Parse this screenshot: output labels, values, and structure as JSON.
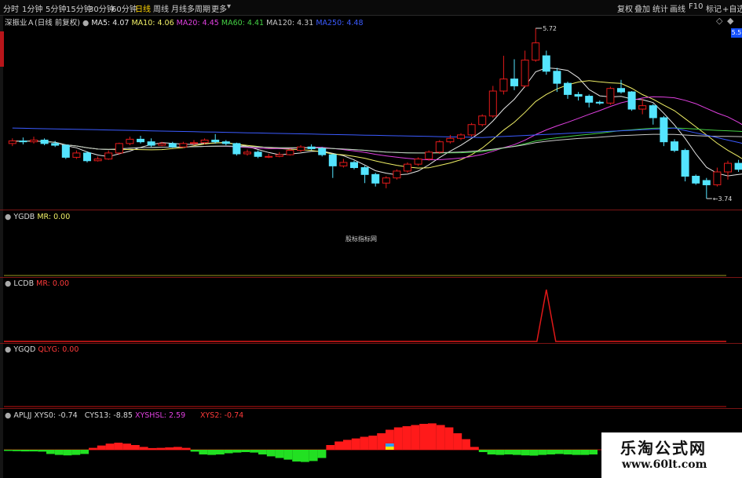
{
  "toolbar": {
    "periods": [
      "分时",
      "1分钟",
      "5分钟",
      "15分钟",
      "30分钟",
      "60分钟",
      "日线",
      "周线",
      "月线",
      "多周期",
      "更多"
    ],
    "active": "日线",
    "right_buttons": [
      "复权",
      "叠加",
      "统计",
      "画线",
      "F10",
      "标记",
      "+自选"
    ]
  },
  "main": {
    "stock_name": "深振业Ａ",
    "mode": "(日线 前复权)",
    "ma_labels": [
      {
        "key": "MA5",
        "text": "MA5: 4.07"
      },
      {
        "key": "MA10",
        "text": "MA10: 4.06"
      },
      {
        "key": "MA20",
        "text": "MA20: 4.45"
      },
      {
        "key": "MA60",
        "text": "MA60: 4.41"
      },
      {
        "key": "MA120",
        "text": "MA120: 4.31"
      },
      {
        "key": "MA250",
        "text": "MA250: 4.48"
      }
    ],
    "high_label": "5.72",
    "low_label": "3.74",
    "right_scale": "5.5"
  },
  "panels": {
    "ygdb": {
      "name": "YGDB",
      "values": [
        "MR: 0.00"
      ],
      "watermark": "股标指标网"
    },
    "lcdb": {
      "name": "LCDB",
      "values": [
        "MR: 0.00"
      ]
    },
    "ygqd": {
      "name": "YGQD",
      "values": [
        "QLYG: 0.00"
      ]
    },
    "apljj": {
      "name": "APLJJ",
      "values": [
        "XYS0: -0.74",
        "CYS13: -8.85",
        "XYSHSL: 2.59",
        "XYS2: -0.74"
      ]
    }
  },
  "logo": {
    "title": "乐淘公式网",
    "url": "www.60lt.com"
  },
  "colors": {
    "up": "#e31a1a",
    "down": "#54e4ff",
    "bg": "#000000",
    "ma5": "#e6e6e6",
    "ma10": "#f0ef66",
    "ma20": "#e040e0",
    "ma60": "#44d044",
    "ma120": "#c8c8c8",
    "ma250": "#3b5bff"
  },
  "chart_data": {
    "type": "candlestick",
    "candles": [
      [
        4.38,
        4.41,
        4.44,
        4.35
      ],
      [
        4.41,
        4.4,
        4.45,
        4.37
      ],
      [
        4.4,
        4.42,
        4.46,
        4.38
      ],
      [
        4.42,
        4.38,
        4.44,
        4.36
      ],
      [
        4.38,
        4.36,
        4.41,
        4.34
      ],
      [
        4.36,
        4.22,
        4.37,
        4.2
      ],
      [
        4.22,
        4.27,
        4.3,
        4.2
      ],
      [
        4.27,
        4.18,
        4.29,
        4.16
      ],
      [
        4.18,
        4.2,
        4.23,
        4.17
      ],
      [
        4.2,
        4.27,
        4.3,
        4.19
      ],
      [
        4.27,
        4.38,
        4.39,
        4.25
      ],
      [
        4.38,
        4.43,
        4.46,
        4.36
      ],
      [
        4.43,
        4.4,
        4.47,
        4.38
      ],
      [
        4.4,
        4.36,
        4.44,
        4.34
      ],
      [
        4.36,
        4.38,
        4.4,
        4.35
      ],
      [
        4.38,
        4.34,
        4.4,
        4.33
      ],
      [
        4.34,
        4.38,
        4.4,
        4.33
      ],
      [
        4.38,
        4.39,
        4.42,
        4.36
      ],
      [
        4.39,
        4.42,
        4.44,
        4.37
      ],
      [
        4.42,
        4.4,
        4.49,
        4.38
      ],
      [
        4.4,
        4.38,
        4.42,
        4.36
      ],
      [
        4.38,
        4.26,
        4.39,
        4.24
      ],
      [
        4.26,
        4.28,
        4.31,
        4.24
      ],
      [
        4.28,
        4.23,
        4.3,
        4.21
      ],
      [
        4.23,
        4.23,
        4.26,
        4.21
      ],
      [
        4.23,
        4.25,
        4.28,
        4.22
      ],
      [
        4.25,
        4.3,
        4.32,
        4.24
      ],
      [
        4.3,
        4.34,
        4.36,
        4.28
      ],
      [
        4.34,
        4.32,
        4.37,
        4.3
      ],
      [
        4.32,
        4.25,
        4.34,
        4.23
      ],
      [
        4.25,
        4.12,
        4.26,
        3.98
      ],
      [
        4.12,
        4.16,
        4.2,
        4.1
      ],
      [
        4.16,
        4.1,
        4.18,
        4.08
      ],
      [
        4.1,
        4.02,
        4.12,
        3.92
      ],
      [
        4.02,
        3.92,
        4.04,
        3.88
      ],
      [
        3.92,
        3.98,
        4.0,
        3.86
      ],
      [
        3.98,
        4.06,
        4.08,
        3.96
      ],
      [
        4.06,
        4.14,
        4.16,
        4.04
      ],
      [
        4.14,
        4.2,
        4.22,
        4.12
      ],
      [
        4.2,
        4.28,
        4.3,
        4.18
      ],
      [
        4.28,
        4.4,
        4.42,
        4.26
      ],
      [
        4.4,
        4.44,
        4.48,
        4.38
      ],
      [
        4.44,
        4.48,
        4.5,
        4.42
      ],
      [
        4.48,
        4.6,
        4.62,
        4.46
      ],
      [
        4.6,
        4.7,
        4.72,
        4.58
      ],
      [
        4.7,
        4.99,
        5.05,
        4.68
      ],
      [
        4.99,
        5.13,
        5.4,
        4.95
      ],
      [
        5.13,
        5.05,
        5.36,
        5.0
      ],
      [
        5.05,
        5.35,
        5.46,
        5.03
      ],
      [
        5.35,
        5.55,
        5.72,
        5.33
      ],
      [
        5.4,
        5.22,
        5.46,
        5.18
      ],
      [
        5.22,
        5.08,
        5.26,
        4.98
      ],
      [
        5.08,
        4.95,
        5.1,
        4.9
      ],
      [
        4.95,
        4.93,
        4.98,
        4.88
      ],
      [
        4.93,
        4.86,
        4.95,
        4.8
      ],
      [
        4.86,
        4.85,
        4.88,
        4.83
      ],
      [
        4.85,
        5.02,
        5.04,
        4.83
      ],
      [
        5.02,
        4.98,
        5.12,
        4.96
      ],
      [
        4.98,
        4.78,
        4.99,
        4.76
      ],
      [
        4.78,
        4.82,
        4.9,
        4.72
      ],
      [
        4.82,
        4.68,
        4.84,
        4.6
      ],
      [
        4.68,
        4.4,
        4.7,
        4.35
      ],
      [
        4.4,
        4.3,
        4.43,
        4.28
      ],
      [
        4.3,
        4.0,
        4.32,
        3.94
      ],
      [
        4.0,
        3.92,
        4.02,
        3.9
      ],
      [
        3.95,
        3.9,
        3.98,
        3.74
      ],
      [
        3.9,
        4.05,
        4.1,
        3.88
      ],
      [
        4.05,
        4.15,
        4.18,
        3.96
      ],
      [
        4.15,
        4.08,
        4.19,
        4.05
      ],
      [
        4.05,
        4.0,
        4.07,
        3.96
      ],
      [
        4.0,
        4.07,
        4.1,
        3.98
      ]
    ],
    "candle_format": [
      "open",
      "close",
      "high",
      "low"
    ],
    "y_range": [
      3.74,
      5.72
    ],
    "lcdb_spike_index": 50,
    "apljj_bars": [
      -0.05,
      -0.06,
      -0.07,
      -0.07,
      -0.08,
      -0.18,
      -0.22,
      -0.24,
      -0.22,
      -0.18,
      0.08,
      0.18,
      0.26,
      0.3,
      0.26,
      0.2,
      0.12,
      0.07,
      0.08,
      0.1,
      0.12,
      0.08,
      -0.08,
      -0.2,
      -0.22,
      -0.2,
      -0.15,
      -0.12,
      -0.1,
      -0.12,
      -0.2,
      -0.28,
      -0.35,
      -0.42,
      -0.5,
      -0.52,
      -0.48,
      -0.35,
      0.2,
      0.35,
      0.42,
      0.48,
      0.55,
      0.6,
      0.7,
      0.85,
      0.95,
      1.0,
      1.05,
      1.1,
      1.12,
      1.05,
      0.95,
      0.7,
      0.45,
      0.12,
      -0.1,
      -0.2,
      -0.22,
      -0.2,
      -0.22,
      -0.24,
      -0.25,
      -0.22,
      -0.2,
      -0.18,
      -0.2,
      -0.22,
      -0.22,
      -0.2,
      -0.18
    ],
    "apljj_highlight_index": 45
  }
}
